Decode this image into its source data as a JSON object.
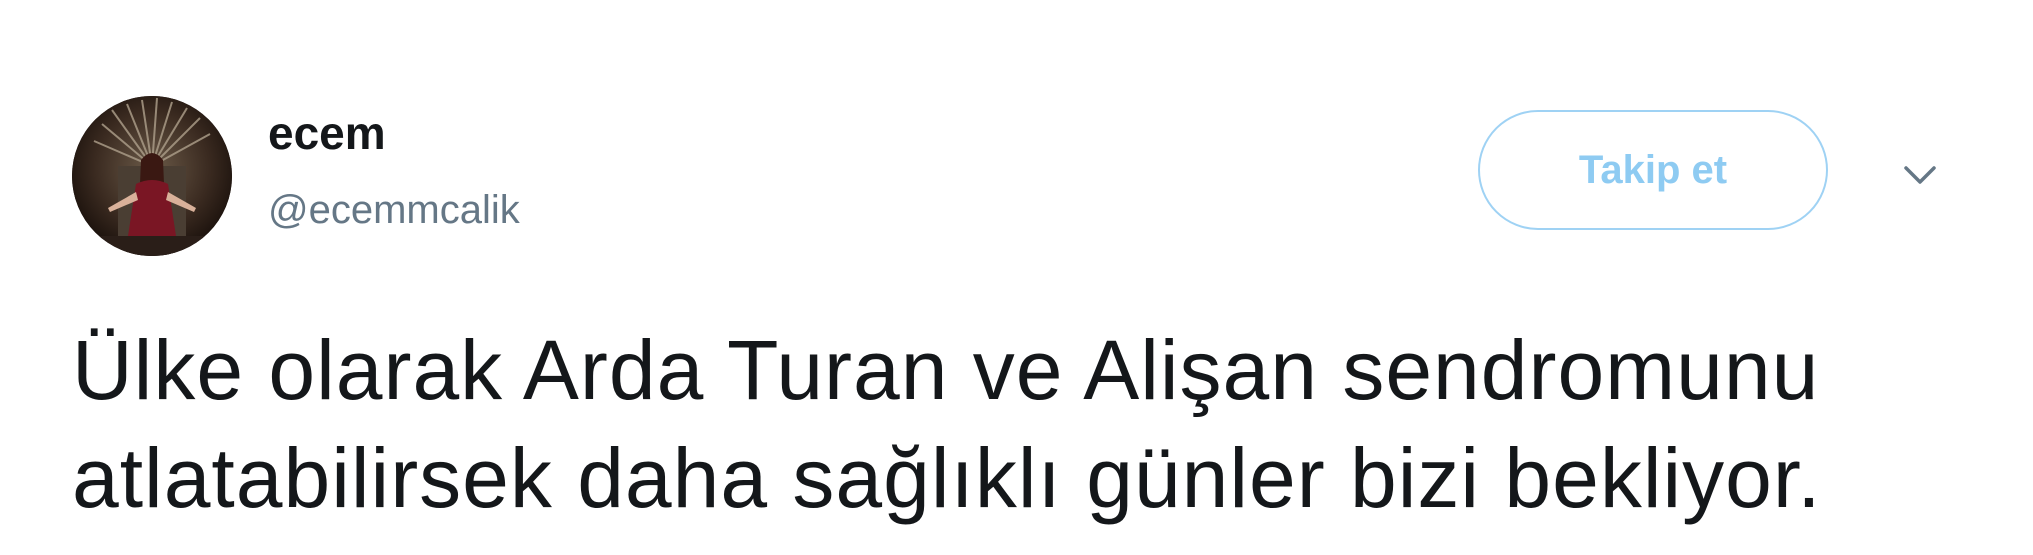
{
  "user": {
    "name": "ecem",
    "handle": "@ecemmcalik"
  },
  "actions": {
    "follow_label": "Takip et",
    "menu_icon": "chevron-down-icon"
  },
  "tweet": {
    "lines": [
      "Ülke olarak Arda Turan ve Alişan sendromunu",
      "atlatabilirsek daha sağlıklı günler bizi bekliyor."
    ]
  },
  "colors": {
    "text": "#14171a",
    "handle": "#657786",
    "follow_accent": "#8ecbf2",
    "follow_border": "#9fd2f4"
  }
}
